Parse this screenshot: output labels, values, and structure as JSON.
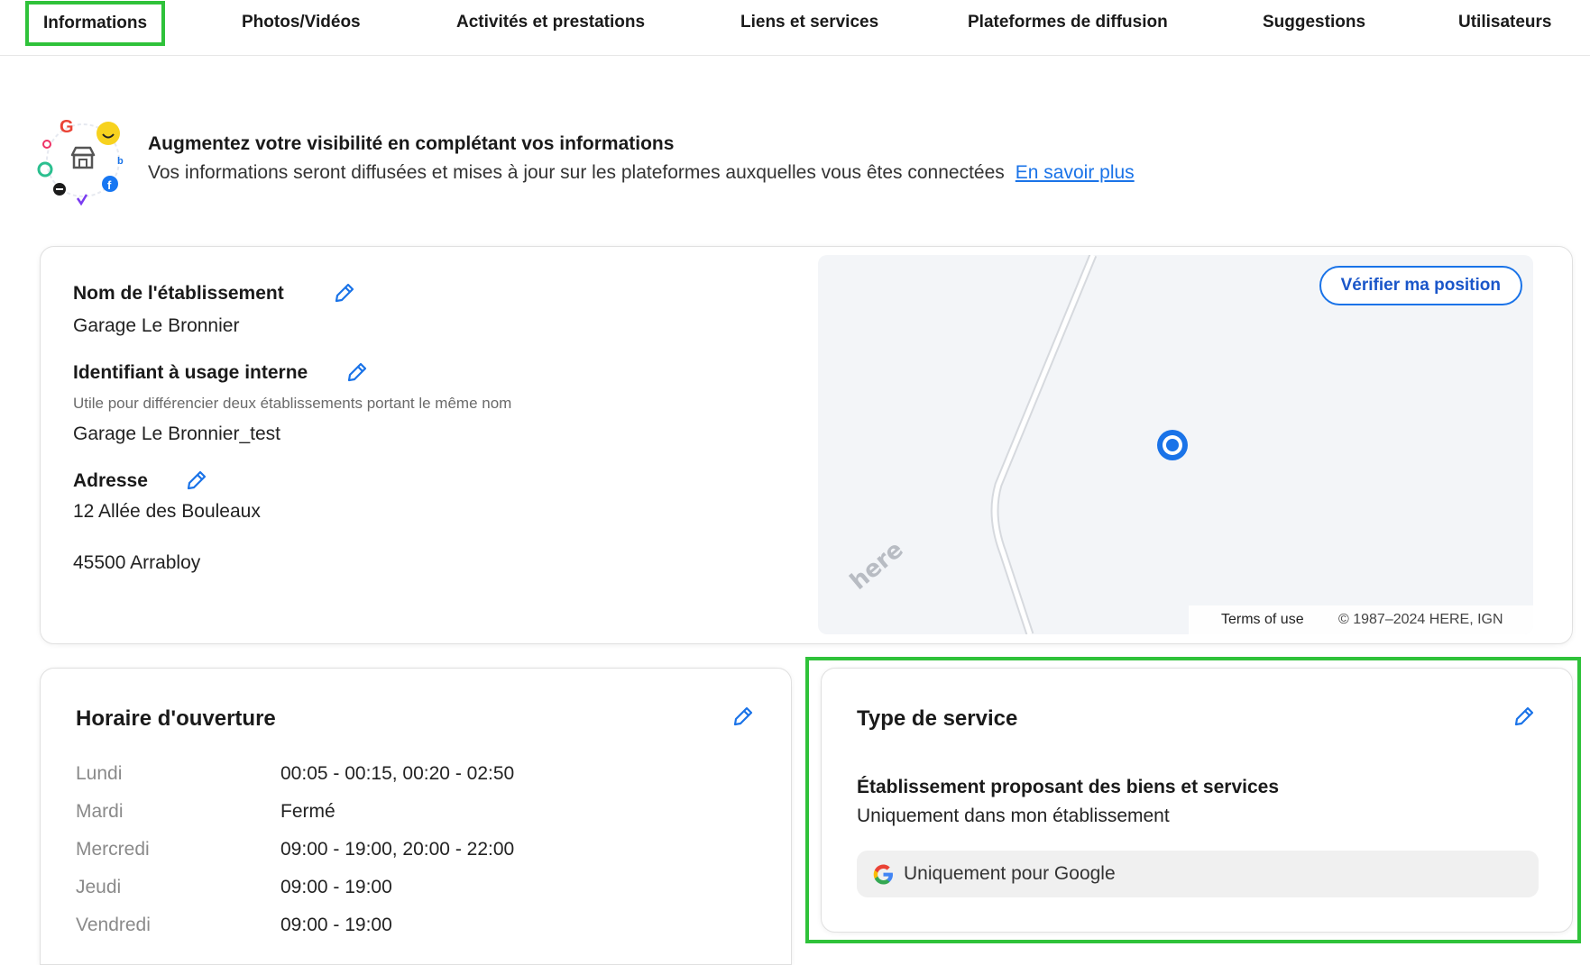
{
  "tabs": [
    {
      "label": "Informations"
    },
    {
      "label": "Photos/Vidéos"
    },
    {
      "label": "Activités et prestations"
    },
    {
      "label": "Liens et services"
    },
    {
      "label": "Plateformes de diffusion"
    },
    {
      "label": "Suggestions"
    },
    {
      "label": "Utilisateurs"
    }
  ],
  "banner": {
    "title": "Augmentez votre visibilité en complétant vos informations",
    "subtitle": "Vos informations seront diffusées et mises à jour sur les plateformes auxquelles vous êtes connectées",
    "link": "En savoir plus"
  },
  "establishment": {
    "name_label": "Nom de l'établissement",
    "name_value": "Garage Le Bronnier",
    "internal_id_label": "Identifiant à usage interne",
    "internal_id_help": "Utile pour différencier deux établissements portant le même nom",
    "internal_id_value": "Garage Le Bronnier_test",
    "address_label": "Adresse",
    "address_line1": "12 Allée des Bouleaux",
    "address_line2": "45500 Arrabloy"
  },
  "map": {
    "verify_button": "Vérifier ma position",
    "logo": "here",
    "terms": "Terms of use",
    "copyright": "© 1987–2024 HERE, IGN",
    "pin_color": "#1a73e8"
  },
  "hours": {
    "title": "Horaire d'ouverture",
    "days": [
      {
        "day": "Lundi",
        "hours": "00:05 - 00:15, 00:20 - 02:50"
      },
      {
        "day": "Mardi",
        "hours": "Fermé"
      },
      {
        "day": "Mercredi",
        "hours": "09:00 - 19:00, 20:00 - 22:00"
      },
      {
        "day": "Jeudi",
        "hours": "09:00 - 19:00"
      },
      {
        "day": "Vendredi",
        "hours": "09:00 - 19:00"
      }
    ]
  },
  "service": {
    "title": "Type de service",
    "type_label": "Établissement proposant des biens et services",
    "type_value": "Uniquement dans mon établissement",
    "chip": "Uniquement pour Google"
  },
  "colors": {
    "accent": "#1a73e8",
    "highlight_outline": "#2fc23a",
    "link": "#1a73e8"
  },
  "icons": {
    "edit": "pencil-icon",
    "google": "google-g-icon",
    "pin": "location-pin-icon"
  }
}
